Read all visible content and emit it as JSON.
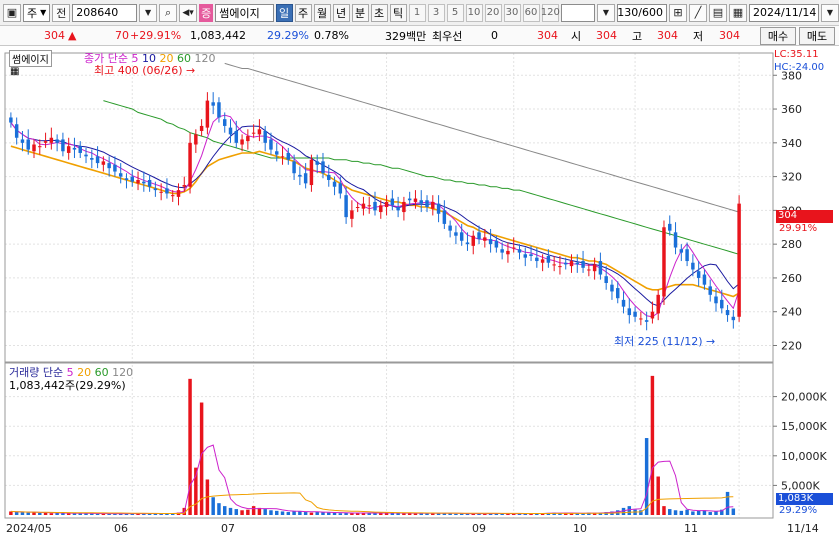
{
  "toolbar": {
    "market_select": "주",
    "prev_label": "전",
    "code": "208640",
    "stock_tag": "증",
    "stock_name": "썸에이지",
    "periods": [
      "일",
      "주",
      "월",
      "년",
      "분",
      "초",
      "틱"
    ],
    "intervals": [
      "1",
      "3",
      "5",
      "10",
      "20",
      "30",
      "60",
      "120"
    ],
    "bar_count": "130/600",
    "date": "2024/11/14"
  },
  "quote": {
    "price": "304",
    "change": "70",
    "change_pct": "+29.91%",
    "volume": "1,083,442",
    "volume_ratio": "29.29%",
    "turnover": "0.78%",
    "trade_value": "329백만",
    "bid_label": "최우선",
    "bid_value": "0",
    "price2": "304",
    "open_label": "시",
    "open": "304",
    "high_label": "고",
    "high": "304",
    "low_label": "저",
    "low": "304",
    "buy_label": "매수",
    "sell_label": "매도"
  },
  "price_panel": {
    "stock_name": "썸에이지",
    "ma_legend": {
      "label": "종가 단순",
      "periods": [
        "5",
        "10",
        "20",
        "60",
        "120"
      ]
    },
    "lc": "LC:35.11",
    "hc": "HC:-24.00",
    "high_note": "최고 400 (06/26)",
    "low_note": "최저 225 (11/12)",
    "y_ticks": [
      "380",
      "360",
      "340",
      "320",
      "300",
      "280",
      "260",
      "240",
      "220"
    ],
    "last_price": "304",
    "last_pct": "29.91%"
  },
  "volume_panel": {
    "ma_legend": {
      "label": "거래량 단순",
      "periods": [
        "5",
        "20",
        "60",
        "120"
      ]
    },
    "summary": "1,083,442주(29.29%)",
    "y_ticks": [
      "20,000K",
      "15,000K",
      "10,000K",
      "5,000K"
    ],
    "last_value": "1,083K",
    "last_pct": "29.29%"
  },
  "x_axis": {
    "labels": [
      "2024/05",
      "06",
      "07",
      "08",
      "09",
      "10",
      "11",
      "11/14"
    ]
  },
  "colors": {
    "up": "#e8141c",
    "down": "#1a6fd8",
    "ma5": "#1a1aa0",
    "ma10": "#1a1aa0",
    "ma20": "#f0a000",
    "ma60": "#2a9a2a",
    "ma120": "#888888",
    "vol_ma5": "#cc22cc"
  },
  "chart_data": {
    "type": "candlestick",
    "x_start": "2024/05",
    "x_end": "2024/11/14",
    "ylim": [
      212,
      392
    ],
    "close": [
      352,
      343,
      340,
      336,
      339,
      338,
      341,
      343,
      340,
      335,
      338,
      336,
      334,
      332,
      330,
      328,
      329,
      325,
      323,
      320,
      318,
      317,
      318,
      316,
      314,
      312,
      311,
      310,
      309,
      312,
      315,
      340,
      345,
      350,
      365,
      362,
      355,
      350,
      345,
      340,
      342,
      344,
      346,
      348,
      340,
      336,
      333,
      332,
      330,
      322,
      320,
      316,
      330,
      327,
      322,
      318,
      314,
      310,
      296,
      300,
      302,
      304,
      303,
      300,
      303,
      305,
      303,
      300,
      305,
      306,
      307,
      304,
      302,
      305,
      298,
      292,
      288,
      285,
      282,
      280,
      285,
      283,
      284,
      280,
      278,
      275,
      276,
      278,
      275,
      272,
      273,
      270,
      271,
      269,
      268,
      267,
      268,
      270,
      268,
      266,
      265,
      268,
      262,
      257,
      252,
      248,
      243,
      238,
      237,
      236,
      234,
      240,
      250,
      290,
      288,
      278,
      275,
      270,
      265,
      260,
      256,
      250,
      245,
      242,
      238,
      235,
      304
    ],
    "ma20": [
      338,
      337,
      336,
      335,
      334,
      333,
      332,
      331,
      330,
      329,
      328,
      327,
      326,
      325,
      324,
      323,
      322,
      321,
      320,
      319,
      318,
      317,
      316,
      315,
      314,
      313,
      312,
      311,
      310,
      310,
      311,
      313,
      317,
      322,
      326,
      328,
      330,
      331,
      332,
      333,
      334,
      334,
      334,
      335,
      334,
      333,
      332,
      331,
      330,
      329,
      327,
      325,
      324,
      323,
      322,
      320,
      318,
      316,
      314,
      312,
      311,
      310,
      309,
      308,
      307,
      306,
      305,
      305,
      304,
      303,
      303,
      302,
      302,
      301,
      300,
      299,
      297,
      295,
      293,
      291,
      290,
      288,
      287,
      286,
      285,
      284,
      283,
      282,
      281,
      280,
      279,
      278,
      277,
      276,
      275,
      274,
      273,
      272,
      272,
      271,
      270,
      270,
      269,
      268,
      266,
      264,
      262,
      260,
      258,
      256,
      254,
      253,
      253,
      254,
      255,
      256,
      256,
      256,
      256,
      255,
      254,
      253,
      252,
      251,
      250,
      249,
      251
    ],
    "ma60": [
      365,
      364,
      363,
      362,
      361,
      360,
      358,
      357,
      356,
      355,
      354,
      352,
      351,
      349,
      348,
      346,
      345,
      344,
      343,
      341,
      340,
      339,
      338,
      337,
      336,
      335,
      334,
      333,
      332,
      331,
      331,
      331,
      331,
      331,
      331,
      331,
      331,
      331,
      331,
      331,
      330,
      330,
      330,
      329,
      329,
      328,
      328,
      327,
      327,
      326,
      325,
      325,
      324,
      323,
      322,
      321,
      320,
      320,
      319,
      318,
      318,
      317,
      317,
      316,
      316,
      315,
      315,
      314,
      314,
      313,
      313,
      312,
      312,
      311,
      310,
      309,
      308,
      307,
      306,
      305,
      304,
      303,
      302,
      301,
      300,
      299,
      298,
      297,
      296,
      295,
      294,
      293,
      292,
      291,
      290,
      289,
      288,
      287,
      286,
      285,
      284,
      283,
      282,
      281,
      280,
      279,
      278,
      277,
      276,
      275,
      274
    ],
    "ma120": [
      387,
      386,
      385,
      384,
      384,
      383,
      382,
      381,
      380,
      379,
      378,
      377,
      376,
      375,
      374,
      373,
      372,
      371,
      370,
      369,
      368,
      367,
      366,
      365,
      364,
      363,
      362,
      361,
      360,
      359,
      358,
      357,
      356,
      355,
      354,
      353,
      352,
      351,
      350,
      349,
      348,
      347,
      346,
      345,
      344,
      343,
      342,
      341,
      340,
      339,
      338,
      337,
      336,
      335,
      334,
      333,
      332,
      331,
      330,
      329,
      328,
      327,
      326,
      325,
      324,
      323,
      322,
      321,
      320,
      319,
      318,
      317,
      316,
      315,
      314,
      313,
      312,
      311,
      310,
      309,
      308,
      307,
      306,
      305,
      304,
      303,
      302,
      301,
      300,
      299
    ],
    "volume_k": [
      600,
      500,
      450,
      400,
      500,
      350,
      400,
      300,
      350,
      300,
      250,
      300,
      250,
      300,
      250,
      200,
      250,
      200,
      250,
      200,
      300,
      250,
      200,
      250,
      300,
      250,
      200,
      250,
      300,
      400,
      1200,
      23000,
      8000,
      19000,
      6000,
      3000,
      2000,
      1500,
      1200,
      1000,
      800,
      900,
      1500,
      1200,
      1000,
      800,
      700,
      600,
      500,
      700,
      600,
      500,
      400,
      500,
      450,
      400,
      350,
      300,
      350,
      300,
      400,
      350,
      300,
      350,
      300,
      400,
      350,
      300,
      250,
      300,
      350,
      300,
      250,
      300,
      350,
      300,
      250,
      200,
      250,
      200,
      300,
      250,
      200,
      250,
      300,
      250,
      200,
      250,
      200,
      250,
      300,
      250,
      300,
      350,
      400,
      300,
      350,
      300,
      250,
      300,
      400,
      350,
      400,
      500,
      600,
      800,
      1200,
      1500,
      900,
      800,
      13000,
      23500,
      6500,
      1500,
      1000,
      800,
      700,
      900,
      600,
      700,
      800,
      500,
      600,
      900,
      3900,
      1100
    ]
  }
}
